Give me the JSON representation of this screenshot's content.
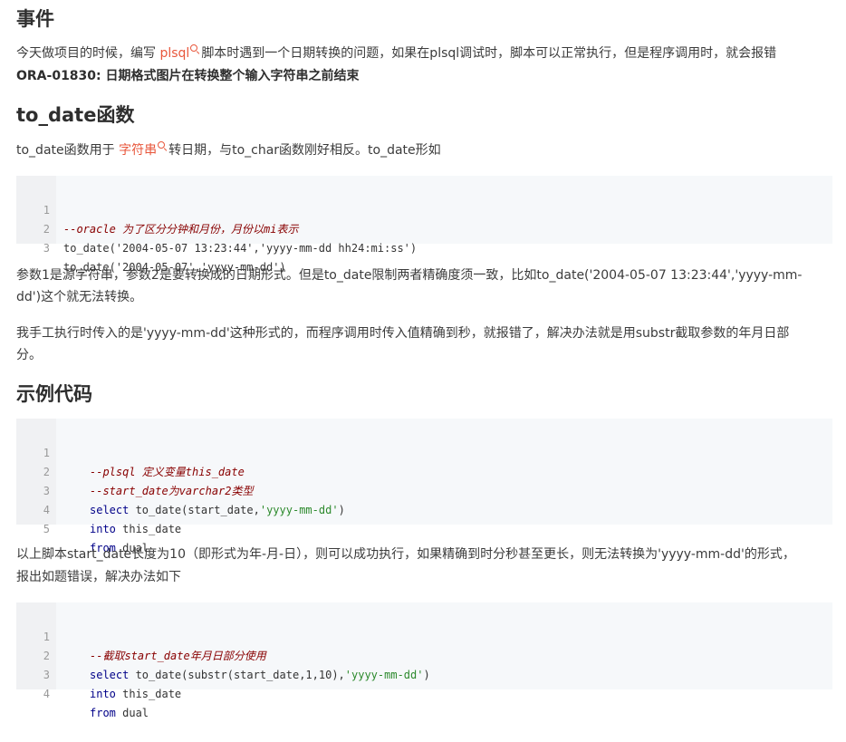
{
  "section1": {
    "heading": "事件",
    "para_before_link": "今天做项目的时候，编写 ",
    "link": "plsql",
    "para_after_link": "脚本时遇到一个日期转换的问题，如果在plsql调试时，脚本可以正常执行，但是程序调用时，就会报错",
    "error_line": "ORA-01830: 日期格式图片在转换整个输入字符串之前结束"
  },
  "section2": {
    "heading": "to_date函数",
    "para_before_link": "to_date函数用于 ",
    "link": "字符串",
    "para_after_link": "转日期，与to_char函数刚好相反。to_date形如",
    "code_lines": [
      {
        "n": "1",
        "text": "--oracle 为了区分分钟和月份，月份以mi表示"
      },
      {
        "n": "2",
        "text": "to_date('2004-05-07 13:23:44','yyyy-mm-dd hh24:mi:ss')"
      },
      {
        "n": "3",
        "text": "to_date('2004-05-07','yyyy-mm-dd')"
      }
    ],
    "para2_line1": "参数1是源字符串，参数2是要转换成的日期形式。但是to_date限制两者精确度须一致，比如to_date('2004-05-07 13:23:44','yyyy-mm-",
    "para2_line2": "dd')这个就无法转换。",
    "para3_line1": "我手工执行时传入的是'yyyy-mm-dd'这种形式的，而程序调用时传入值精确到秒，就报错了，解决办法就是用substr截取参数的年月日部",
    "para3_line2": "分。"
  },
  "section3": {
    "heading": "示例代码",
    "code_lines": [
      {
        "n": "1",
        "comment": "--plsql 定义变量this_date"
      },
      {
        "n": "2",
        "comment": "--start_date为varchar2类型"
      },
      {
        "n": "3",
        "kw": "select",
        "rest_a": " to_date(start_date,",
        "str": "'yyyy-mm-dd'",
        "rest_b": ")"
      },
      {
        "n": "4",
        "kw": "into",
        "rest_a": " this_date"
      },
      {
        "n": "5",
        "kw": "from",
        "rest_a": " dual"
      }
    ],
    "para_line1": "以上脚本start_date长度为10（即形式为年-月-日），则可以成功执行，如果精确到时分秒甚至更长，则无法转换为'yyyy-mm-dd'的形式，",
    "para_line2": "报出如题错误，解决办法如下",
    "code2_lines": [
      {
        "n": "1",
        "comment": "--截取start_date年月日部分使用"
      },
      {
        "n": "2",
        "kw": "select",
        "rest_a": " to_date(substr(start_date,1,10),",
        "str": "'yyyy-mm-dd'",
        "rest_b": ")"
      },
      {
        "n": "3",
        "kw": "into",
        "rest_a": " this_date"
      },
      {
        "n": "4",
        "kw": "from",
        "rest_a": " dual"
      }
    ]
  }
}
